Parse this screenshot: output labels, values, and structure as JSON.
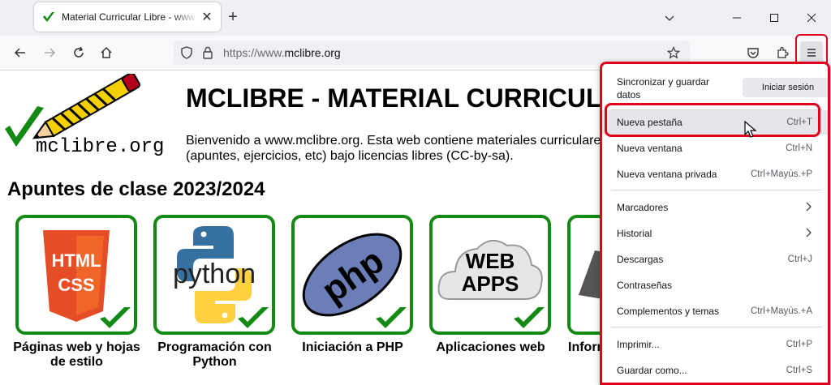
{
  "browser": {
    "tab_title": "Material Curricular Libre - www.mclibre.org",
    "url_prefix": "https://www.",
    "url_domain": "mclibre.org"
  },
  "page": {
    "logo_text": "mclibre.org",
    "title": "MCLIBRE - MATERIAL CURRICULAR LIBRE",
    "intro": "Bienvenido a www.mclibre.org. Esta web contiene materiales curriculares (apuntes, ejercicios, etc) bajo licencias libres (CC-by-sa).",
    "section_title": "Apuntes de clase 2023/2024",
    "cards": [
      {
        "label": "Páginas web y hojas de estilo",
        "icon_text_1": "HTML",
        "icon_text_2": "CSS"
      },
      {
        "label": "Programación con Python",
        "icon_text_1": "python"
      },
      {
        "label": "Iniciación a PHP",
        "icon_text_1": "php"
      },
      {
        "label": "Aplicaciones web",
        "icon_text_1": "WEB",
        "icon_text_2": "APPS"
      },
      {
        "label": "Informática"
      }
    ]
  },
  "menu": {
    "sync_label": "Sincronizar y guardar datos",
    "login_button": "Iniciar sesión",
    "new_tab": {
      "label": "Nueva pestaña",
      "shortcut": "Ctrl+T"
    },
    "new_window": {
      "label": "Nueva ventana",
      "shortcut": "Ctrl+N"
    },
    "new_private": {
      "label": "Nueva ventana privada",
      "shortcut": "Ctrl+Mayús.+P"
    },
    "bookmarks": {
      "label": "Marcadores"
    },
    "history": {
      "label": "Historial"
    },
    "downloads": {
      "label": "Descargas",
      "shortcut": "Ctrl+J"
    },
    "passwords": {
      "label": "Contraseñas"
    },
    "addons": {
      "label": "Complementos y temas",
      "shortcut": "Ctrl+Mayús.+A"
    },
    "print": {
      "label": "Imprimir...",
      "shortcut": "Ctrl+P"
    },
    "save_as": {
      "label": "Guardar como...",
      "shortcut": "Ctrl+S"
    }
  },
  "colors": {
    "highlight_red": "#e0001b",
    "check_green": "#138a13",
    "firefox_bg": "#f0f0f4"
  },
  "icons": [
    "checkmark-favicon",
    "close-icon",
    "plus-icon",
    "chevron-down-icon",
    "minimize-icon",
    "maximize-icon",
    "back-icon",
    "forward-icon",
    "reload-icon",
    "home-icon",
    "shield-icon",
    "lock-icon",
    "star-icon",
    "pocket-icon",
    "extensions-icon",
    "hamburger-menu-icon",
    "chevron-right-icon",
    "cursor-icon"
  ]
}
